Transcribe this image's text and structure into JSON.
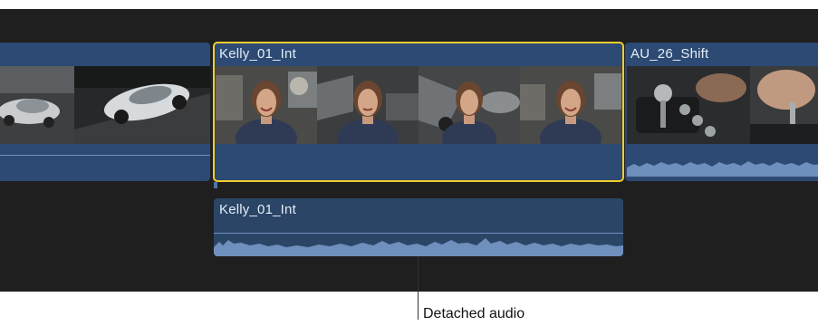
{
  "timeline": {
    "clips": {
      "car_clip": {
        "title": ""
      },
      "selected_clip": {
        "title": "Kelly_01_Int"
      },
      "next_clip": {
        "title": "AU_26_Shift"
      },
      "detached_audio_clip": {
        "title": "Kelly_01_Int"
      }
    },
    "selection_color": "#f1cd2c",
    "clip_color": "#2c4a73"
  },
  "callout": {
    "label": "Detached audio"
  }
}
